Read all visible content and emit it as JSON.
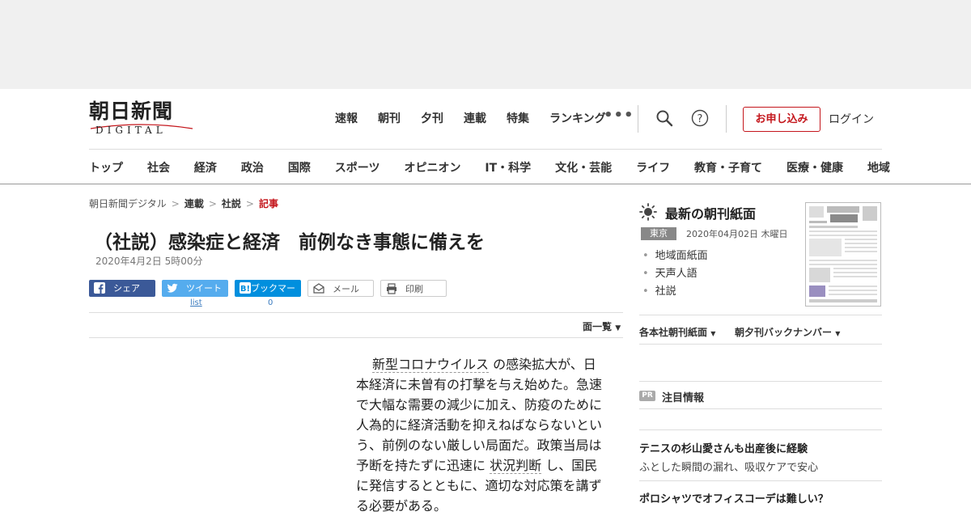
{
  "logo": {
    "main": "朝日新聞",
    "sub": "DIGITAL"
  },
  "topnav": [
    "速報",
    "朝刊",
    "夕刊",
    "連載",
    "特集",
    "ランキング"
  ],
  "more_label": "•••",
  "apply_label": "お申し込み",
  "login_label": "ログイン",
  "sections": [
    "トップ",
    "社会",
    "経済",
    "政治",
    "国際",
    "スポーツ",
    "オピニオン",
    "IT・科学",
    "文化・芸能",
    "ライフ",
    "教育・子育て",
    "医療・健康",
    "地域"
  ],
  "breadcrumb": [
    "朝日新聞デジタル",
    "連載",
    "社説",
    "記事"
  ],
  "article": {
    "title": "（社説）感染症と経済　前例なき事態に備えを",
    "date": "2020年4月2日 5時00分",
    "body": {
      "p1": "新型コロナウイルス",
      "p2": "の感染拡大が、日本経済に未曽有の打撃を与え始めた。急速で大幅な需要の減少に加え、防疫のために人為的に経済活動を抑えねばならないという、前例のない厳しい局面だ。政策当局は予断を持たずに迅速に",
      "p3": "状況判断",
      "p4": "し、国民に発信するとともに、適切な対応策を講ずる必要がある。"
    }
  },
  "share": {
    "facebook": "シェア",
    "twitter": "ツイート",
    "hatena": "ブックマーク",
    "mail": "メール",
    "print": "印刷",
    "twitter_count": "list",
    "hatena_count": "0"
  },
  "menkan_label": "面一覧",
  "sidebar": {
    "title": "最新の朝刊紙面",
    "region": "東京",
    "paper_date": "2020年04月02日 木曜日",
    "links": [
      "地域面紙面",
      "天声人語",
      "社説"
    ],
    "dropdown1": "各本社朝刊紙面",
    "dropdown2": "朝夕刊バックナンバー",
    "pr_badge": "PR",
    "pr_title": "注目情報",
    "ads": [
      {
        "headline": "テニスの杉山愛さんも出産後に経験",
        "sub": "ふとした瞬間の漏れ、吸収ケアで安心"
      },
      {
        "headline": "ポロシャツでオフィスコーデは難しい？",
        "sub": ""
      }
    ]
  },
  "colors": {
    "accent": "#c4161c",
    "facebook": "#3b5998",
    "twitter": "#55acee",
    "hatena": "#008fde"
  }
}
